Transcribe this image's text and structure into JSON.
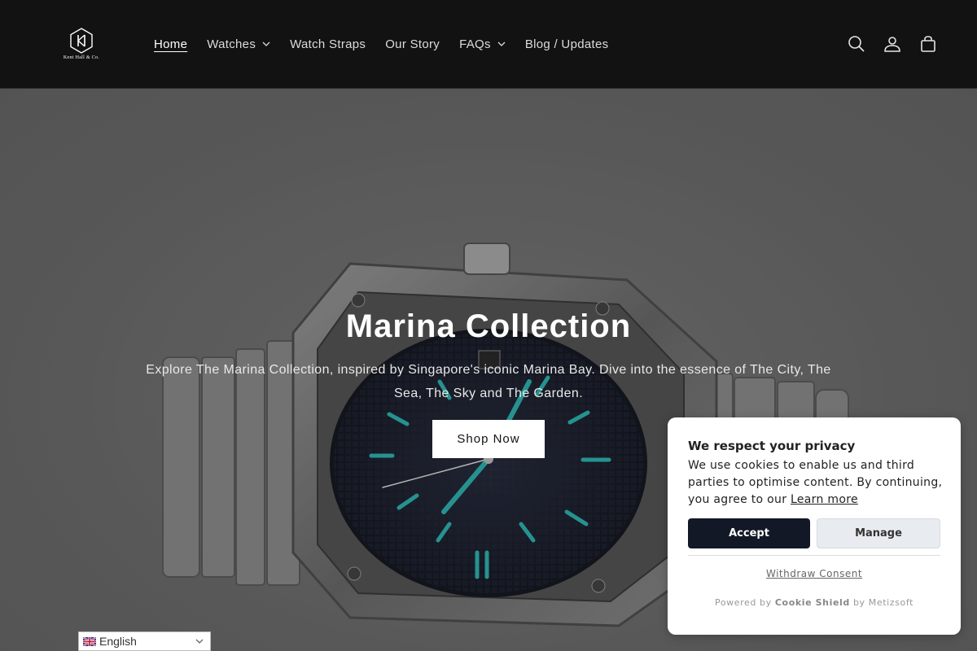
{
  "brand": {
    "logo_text": "Kent Hall & Co."
  },
  "nav": {
    "items": [
      {
        "label": "Home",
        "active": true,
        "dropdown": false
      },
      {
        "label": "Watches",
        "active": false,
        "dropdown": true
      },
      {
        "label": "Watch Straps",
        "active": false,
        "dropdown": false
      },
      {
        "label": "Our Story",
        "active": false,
        "dropdown": false
      },
      {
        "label": "FAQs",
        "active": false,
        "dropdown": true
      },
      {
        "label": "Blog / Updates",
        "active": false,
        "dropdown": false
      }
    ]
  },
  "header_icons": [
    "search-icon",
    "account-icon",
    "cart-icon"
  ],
  "hero": {
    "title": "Marina Collection",
    "subtitle": "Explore The Marina Collection, inspired by Singapore's iconic Marina Bay. Dive into the essence of The City, The Sea, The Sky and The Garden.",
    "button_label": "Shop Now"
  },
  "language": {
    "selected": "English"
  },
  "cookie": {
    "title": "We respect your privacy",
    "body": "We use cookies to enable us and third parties to optimise content. By continuing, you agree to our",
    "learn_more": "Learn more",
    "accept_label": "Accept",
    "manage_label": "Manage",
    "withdraw_label": "Withdraw Consent",
    "powered_prefix": "Powered by",
    "powered_brand": "Cookie Shield",
    "powered_suffix": "by Metizsoft"
  },
  "colors": {
    "header_bg": "#121212",
    "accept_bg": "#121826",
    "lume_accent": "#2fb3b0"
  }
}
